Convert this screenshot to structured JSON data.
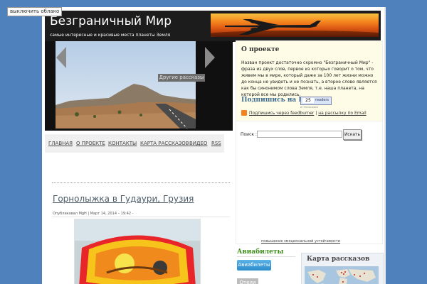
{
  "cloud_button": "выключить облако",
  "header": {
    "title": "Безграничный Мир",
    "tagline": "самые интересные и красивые места планеты Земля"
  },
  "slider": {
    "tab_label": "Другие рассказы"
  },
  "nav": [
    "ГЛАВНАЯ",
    "О ПРОЕКТЕ",
    "КОНТАКТЫ",
    "КАРТА РАССКАЗОВ",
    "ВИДЕО",
    "RSS"
  ],
  "post": {
    "title": "Горнолыжка в Гудаури, Грузия",
    "meta": "Опубликовал MgH | Март 14, 2014 – 19:42 -"
  },
  "about": {
    "title": "О проекте",
    "text": "Назван проект достаточно скромно \"Безграничный Мир\" - фраза из двух слов, первое из которых говорит о том, что живем мы в мире, который даже за 100 лет жизни можно до конца не увидеть и не познать, а второе слово является как бы синонимом слова Земля, т.е. наша планета, на которой все мы родились."
  },
  "rss": {
    "title": "Подпишись на RSS!",
    "readers_count": "25",
    "readers_label": "readers",
    "readers_by": "BY FEEDBURNER",
    "link_feedburner": "Подпишись через feedburner",
    "separator": "|",
    "link_email": "на рассылку по Email"
  },
  "search": {
    "label": "Поиск :",
    "value": "",
    "button": "Искать"
  },
  "emotional_link": "повышение эмоциональной устойчивости",
  "airline": {
    "title": "Авиабилеты",
    "tab_active": "Авиабилеты",
    "tab_hotels": "Отели"
  },
  "map": {
    "title": "Карта рассказов"
  },
  "colors": {
    "background": "#4f82bc",
    "header": "#1c1c1c",
    "about_bg": "#fefce6",
    "airline_title": "#3d8a1a",
    "tab_active": "#2b8ccb"
  }
}
